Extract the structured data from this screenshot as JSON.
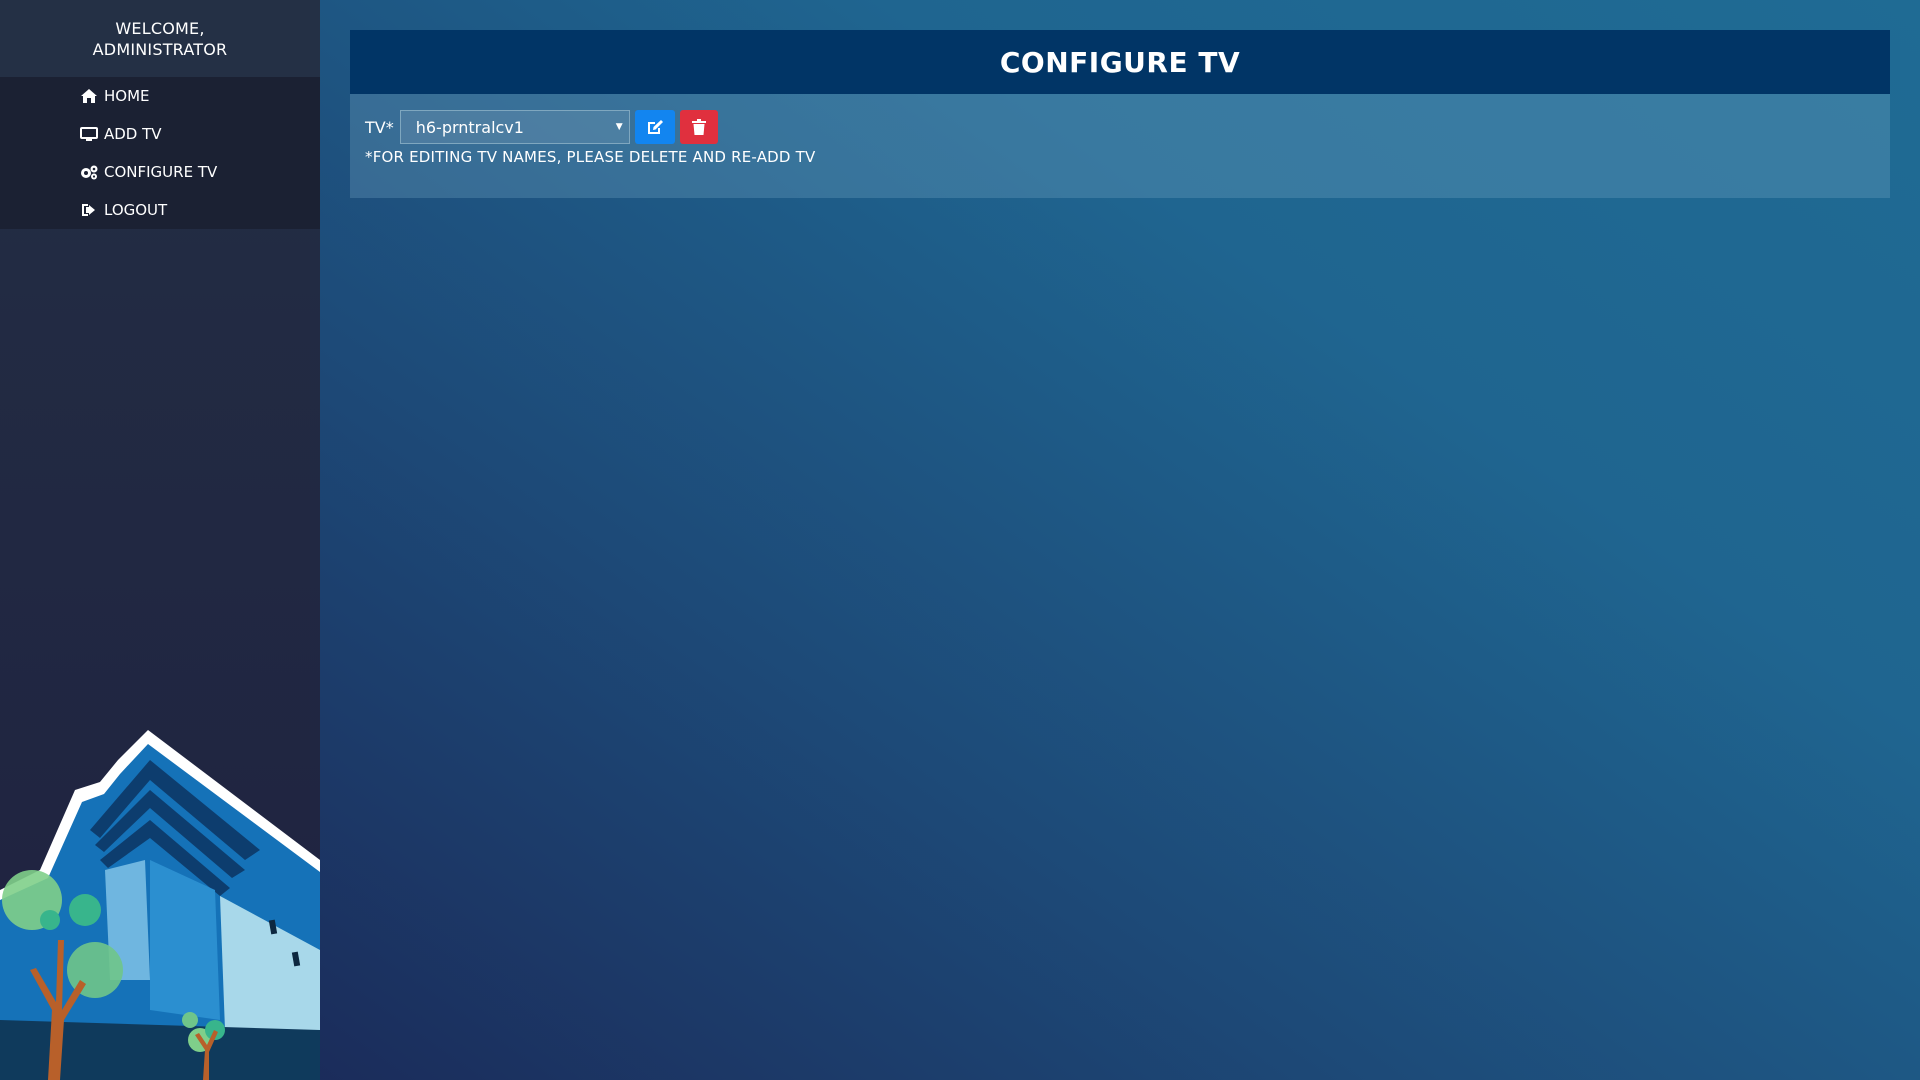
{
  "sidebar": {
    "welcome_line1": "WELCOME,",
    "welcome_line2": "ADMINISTRATOR",
    "items": [
      {
        "label": "HOME",
        "icon": "home-icon"
      },
      {
        "label": "ADD TV",
        "icon": "monitor-icon"
      },
      {
        "label": "CONFIGURE TV",
        "icon": "gears-icon"
      },
      {
        "label": "LOGOUT",
        "icon": "sign-out-icon"
      }
    ]
  },
  "panel": {
    "title": "CONFIGURE TV",
    "tv_label": "TV*",
    "tv_selected": "h6-prntralcv1",
    "note": "*FOR EDITING TV NAMES, PLEASE DELETE AND RE-ADD TV",
    "edit_icon": "edit-icon",
    "delete_icon": "trash-icon"
  },
  "colors": {
    "header_bg": "#013566",
    "edit_button": "#1285f0",
    "delete_button": "#e0303e",
    "sidebar_bg": "#1b2133"
  }
}
